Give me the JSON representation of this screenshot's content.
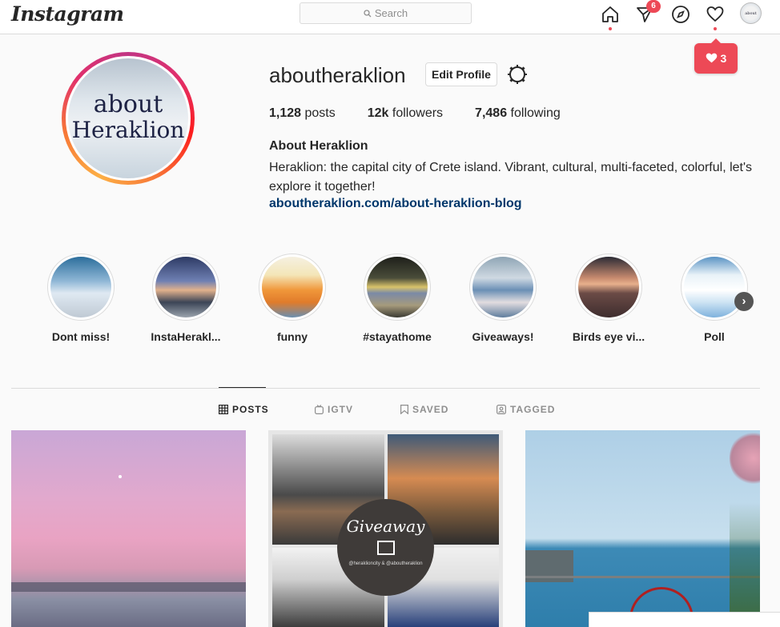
{
  "nav": {
    "logo": "Instagram",
    "search_placeholder": "Search",
    "notification_badge": "6",
    "likes_popup_count": "3",
    "avatar_text": "about Heraklion"
  },
  "profile": {
    "username": "aboutheraklion",
    "edit_button": "Edit Profile",
    "avatar_text_line1": "about",
    "avatar_text_line2": "Heraklion",
    "stats": {
      "posts_value": "1,128",
      "posts_label": "posts",
      "followers_value": "12k",
      "followers_label": "followers",
      "following_value": "7,486",
      "following_label": "following"
    },
    "full_name": "About Heraklion",
    "bio": "Heraklion: the capital city of Crete island. Vibrant, cultural, multi-faceted, colorful, let's explore it together!",
    "link": "aboutheraklion.com/about-heraklion-blog"
  },
  "highlights": [
    {
      "label": "Dont miss!",
      "color": "#3b7fb5"
    },
    {
      "label": "InstaHerakl...",
      "color": "#3d4a6b"
    },
    {
      "label": "funny",
      "color": "#e98a2f"
    },
    {
      "label": "#stayathome",
      "color": "#6b6f4a"
    },
    {
      "label": "Giveaways!",
      "color": "#4f7fa8"
    },
    {
      "label": "Birds eye vi...",
      "color": "#b27a5b"
    },
    {
      "label": "Poll",
      "color": "#6fa9d8"
    }
  ],
  "tabs": [
    {
      "label": "POSTS",
      "icon": "grid-icon"
    },
    {
      "label": "IGTV",
      "icon": "igtv-icon"
    },
    {
      "label": "SAVED",
      "icon": "bookmark-icon"
    },
    {
      "label": "TAGGED",
      "icon": "tagged-icon"
    }
  ],
  "posts": {
    "giveaway_title": "Giveaway",
    "giveaway_sub": "@heraklioncity & @aboutheraklion"
  },
  "colors": {
    "accent_red": "#ed4956",
    "link_blue": "#00376b"
  }
}
